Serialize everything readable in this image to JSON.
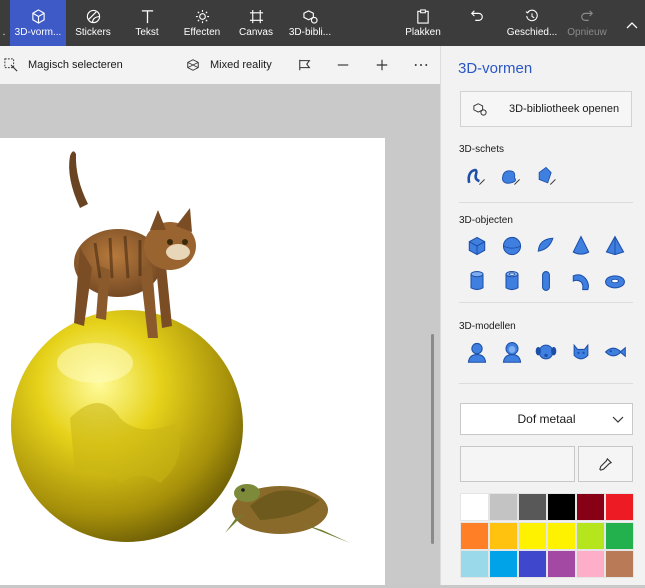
{
  "toolbar": {
    "tools": [
      {
        "label": "3D-vorm...",
        "icon": "cube-icon",
        "active": true
      },
      {
        "label": "Stickers",
        "icon": "sticker-icon"
      },
      {
        "label": "Tekst",
        "icon": "text-icon"
      },
      {
        "label": "Effecten",
        "icon": "sun-icon"
      },
      {
        "label": "Canvas",
        "icon": "canvas-icon"
      },
      {
        "label": "3D-bibli...",
        "icon": "library-icon"
      }
    ],
    "paste_label": "Plakken",
    "history_label": "Geschied...",
    "redo_label": "Opnieuw"
  },
  "subtoolbar": {
    "magic_select_label": "Magisch selecteren",
    "mixed_reality_label": "Mixed reality"
  },
  "panel": {
    "title": "3D-vormen",
    "library_button": "3D-bibliotheek openen",
    "sketch_label": "3D-schets",
    "objects_label": "3D-objecten",
    "models_label": "3D-modellen",
    "material": "Dof metaal",
    "sketch_shapes": [
      "sharp-edge-doodle-icon",
      "soft-edge-doodle-icon",
      "tube-doodle-icon"
    ],
    "object_shapes": [
      "cube-icon",
      "sphere-icon",
      "hemisphere-icon",
      "cone-icon",
      "pyramid-icon",
      "cylinder-icon",
      "tube-icon",
      "capsule-icon",
      "curved-tube-icon",
      "donut-icon"
    ],
    "model_shapes": [
      "man-icon",
      "woman-icon",
      "dog-icon",
      "cat-icon",
      "fish-icon"
    ]
  },
  "palette": [
    "#ffffff",
    "#c3c3c3",
    "#585858",
    "#000000",
    "#880015",
    "#ed1c24",
    "#ff7f27",
    "#ffc20e",
    "#fff200",
    "#fef200",
    "#b5e61d",
    "#22b14c",
    "#99d9ea",
    "#00a2e8",
    "#3f48cc",
    "#a349a4",
    "#ffaec9",
    "#b97a57"
  ],
  "colors": {
    "accent": "#2b57c6",
    "active_tool": "#3d5ac6",
    "toolbar_bg": "#3c3c3c"
  }
}
